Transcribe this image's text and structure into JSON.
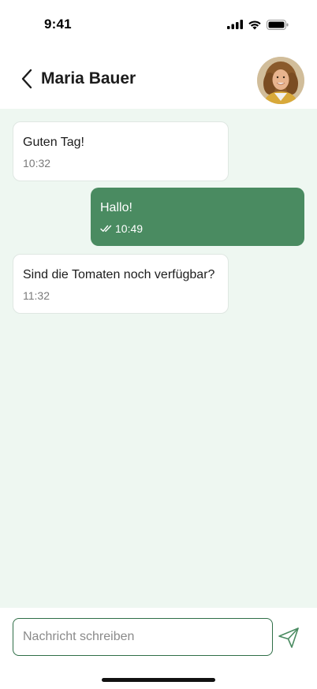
{
  "status_bar": {
    "time": "9:41",
    "icons": [
      "cellular-signal-icon",
      "wifi-icon",
      "battery-icon"
    ]
  },
  "header": {
    "back_icon": "chevron-left-icon",
    "contact_name": "Maria Bauer",
    "avatar": "avatar-photo"
  },
  "messages": [
    {
      "direction": "incoming",
      "text": "Guten Tag!",
      "time": "10:32"
    },
    {
      "direction": "outgoing",
      "text": "Hallo!",
      "time": "10:49",
      "status_icon": "double-check-icon"
    },
    {
      "direction": "incoming",
      "text": "Sind die Tomaten noch verfügbar?",
      "time": "11:32"
    }
  ],
  "composer": {
    "placeholder": "Nachricht schreiben",
    "send_icon": "paper-plane-icon"
  },
  "colors": {
    "chat_background": "#eef7f1",
    "outgoing_bubble": "#4a8b61",
    "accent_border": "#2f6e47"
  }
}
